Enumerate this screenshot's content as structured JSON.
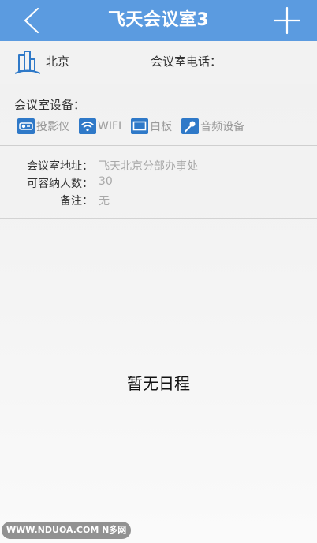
{
  "header": {
    "title": "飞天会议室3",
    "back_icon": "chevron-left-icon",
    "add_icon": "plus-icon",
    "background": "#5b9be0"
  },
  "info": {
    "city": "北京",
    "phone_label": "会议室电话："
  },
  "equipment": {
    "title": "会议室设备：",
    "items": [
      {
        "label": "投影仪",
        "icon": "projector-icon"
      },
      {
        "label": "WIFI",
        "icon": "wifi-icon"
      },
      {
        "label": "白板",
        "icon": "whiteboard-icon"
      },
      {
        "label": "音频设备",
        "icon": "microphone-icon"
      }
    ],
    "icon_color": "#2f79c8"
  },
  "details": [
    {
      "label": "会议室地址：",
      "value": "飞天北京分部办事处"
    },
    {
      "label": "可容纳人数：",
      "value": "30"
    },
    {
      "label": "备注：",
      "value": "无"
    }
  ],
  "schedule": {
    "empty_text": "暂无日程"
  },
  "watermark": {
    "text": "WWW.NDUOA.COM N多网"
  }
}
